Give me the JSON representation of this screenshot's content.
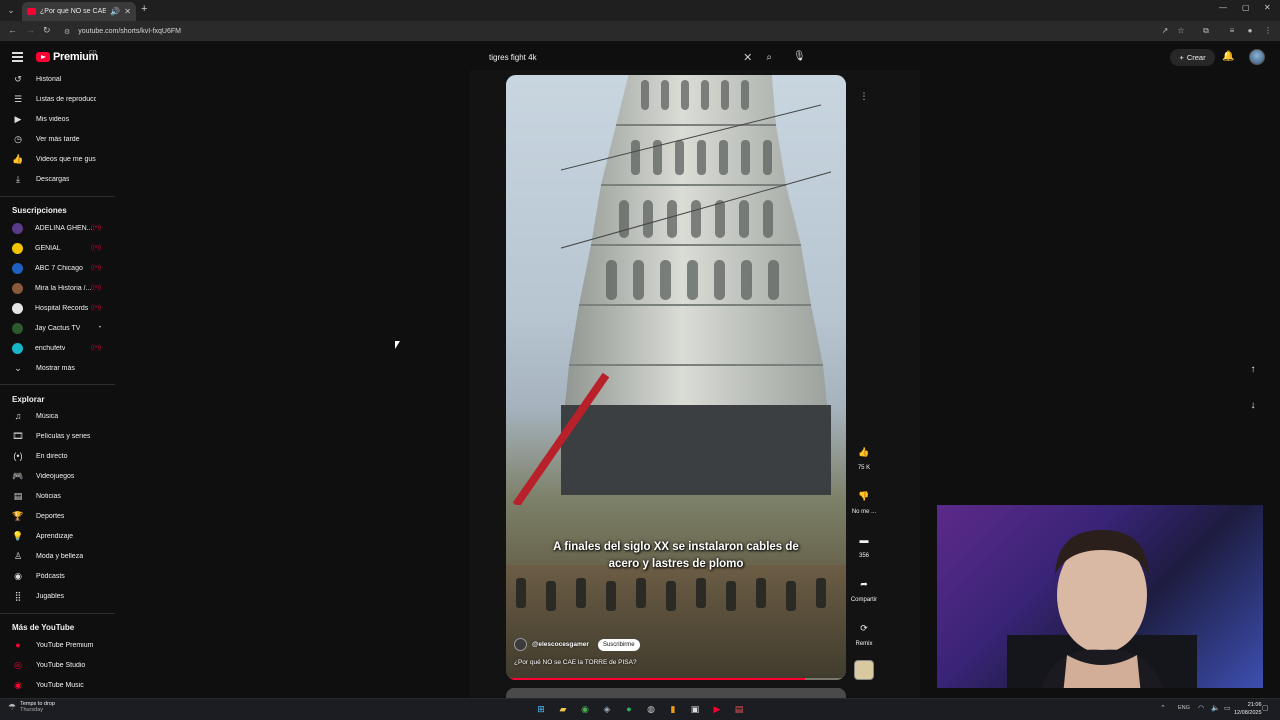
{
  "browser": {
    "tab_title": "¿Por qué NO se CAE la TORR",
    "url": "youtube.com/shorts/kvI-fxqU6FM"
  },
  "header": {
    "brand": "Premium",
    "region": "CO",
    "search_value": "tigres fight  4k",
    "create_label": "Crear"
  },
  "sidebar": {
    "you_items": [
      {
        "label": "Historial",
        "icon": "history-icon"
      },
      {
        "label": "Listas de reproducc...",
        "icon": "playlist-icon"
      },
      {
        "label": "Mis videos",
        "icon": "my-videos-icon"
      },
      {
        "label": "Ver más tarde",
        "icon": "watch-later-icon"
      },
      {
        "label": "Videos que me gus...",
        "icon": "liked-icon"
      },
      {
        "label": "Descargas",
        "icon": "download-icon"
      }
    ],
    "subs_title": "Suscripciones",
    "subscriptions": [
      {
        "label": "ADELINA GHEN...",
        "color": "#5a3b8a",
        "live": true
      },
      {
        "label": "GENIAL",
        "color": "#f2c400",
        "live": true
      },
      {
        "label": "ABC 7 Chicago",
        "color": "#1f5fbf",
        "live": true
      },
      {
        "label": "Mira la Historia /...",
        "color": "#8a5a3b",
        "live": true
      },
      {
        "label": "Hospital Records",
        "color": "#e6e6e6",
        "live": true
      },
      {
        "label": "Jay Cactus TV",
        "color": "#2d5a2d",
        "live": false
      },
      {
        "label": "enchufetv",
        "color": "#16b5c9",
        "live": true
      }
    ],
    "show_more": "Mostrar más",
    "explore_title": "Explorar",
    "explore": [
      {
        "label": "Música",
        "icon": "music-icon"
      },
      {
        "label": "Películas y series",
        "icon": "movies-icon"
      },
      {
        "label": "En directo",
        "icon": "live-icon"
      },
      {
        "label": "Videojuegos",
        "icon": "gaming-icon"
      },
      {
        "label": "Noticias",
        "icon": "news-icon"
      },
      {
        "label": "Deportes",
        "icon": "sports-icon"
      },
      {
        "label": "Aprendizaje",
        "icon": "learning-icon"
      },
      {
        "label": "Moda y belleza",
        "icon": "fashion-icon"
      },
      {
        "label": "Pódcasts",
        "icon": "podcast-icon"
      },
      {
        "label": "Jugables",
        "icon": "playables-icon"
      }
    ],
    "more_title": "Más de YouTube",
    "more": [
      {
        "label": "YouTube Premium"
      },
      {
        "label": "YouTube Studio"
      },
      {
        "label": "YouTube Music"
      }
    ]
  },
  "short": {
    "caption_line1": "A finales del siglo XX se instalaron cables de",
    "caption_line2": "acero y lastres de plomo",
    "channel": "@elescocesgamer",
    "subscribe": "Suscribirme",
    "title": "¿Por qué NO se CAE la TORRE de PISA?",
    "progress": 0.88,
    "likes": "75 K",
    "dislike": "No me ...",
    "comments": "356",
    "share": "Compartir",
    "remix": "Remix"
  },
  "taskbar": {
    "weather_line1": "Temps to drop",
    "weather_line2": "Thursday",
    "lang": "ENG",
    "time": "21:06",
    "date": "12/08/2025"
  }
}
